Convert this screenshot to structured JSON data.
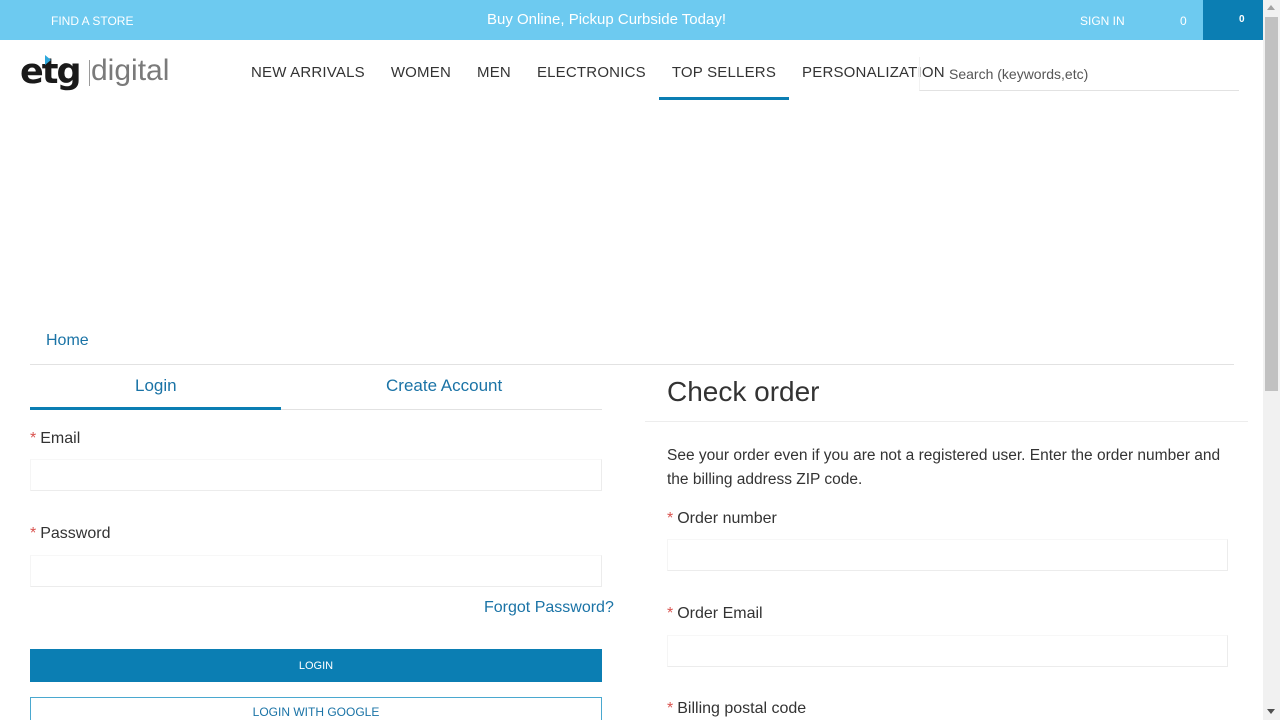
{
  "topbar": {
    "find_store": "FIND A STORE",
    "promo": "Buy Online, Pickup Curbside Today!",
    "sign_in": "SIGN IN",
    "wishlist_count": "0",
    "cart_count": "0",
    "bg_color": "#6dcaf0",
    "cart_color": "#0b7eb3"
  },
  "logo": {
    "brand": "etg",
    "suffix": "digital"
  },
  "nav": {
    "items": [
      "NEW ARRIVALS",
      "WOMEN",
      "MEN",
      "ELECTRONICS",
      "TOP SELLERS",
      "PERSONALIZATION"
    ],
    "active": "TOP SELLERS"
  },
  "search": {
    "placeholder": "Search (keywords,etc)"
  },
  "breadcrumb": {
    "home": "Home"
  },
  "login": {
    "tab_login": "Login",
    "tab_create": "Create Account",
    "email_label": "Email",
    "password_label": "Password",
    "required_mark": "*",
    "forgot": "Forgot Password?",
    "login_button": "LOGIN",
    "google_button": "LOGIN WITH GOOGLE",
    "email_value": "",
    "password_value": ""
  },
  "check_order": {
    "title": "Check order",
    "description": "See your order even if you are not a registered user. Enter the order number and the billing address ZIP code.",
    "order_number_label": "Order number",
    "order_email_label": "Order Email",
    "postal_label": "Billing postal code",
    "order_number_value": "",
    "order_email_value": ""
  },
  "colors": {
    "accent": "#0b7eb3",
    "link": "#1a73a6",
    "required": "#d9534f"
  }
}
